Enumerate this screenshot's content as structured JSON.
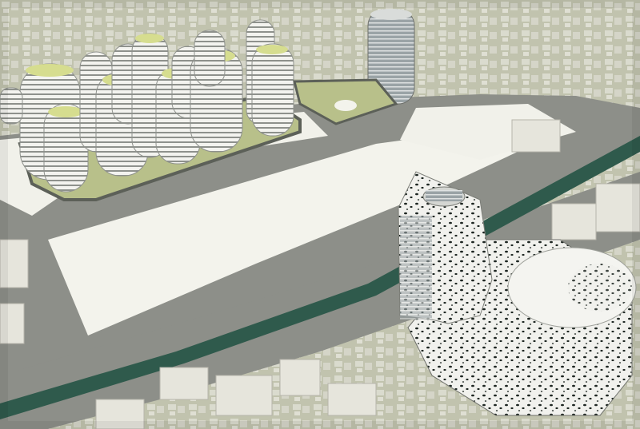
{
  "scene": {
    "kind": "architectural-render",
    "palette": {
      "sky_ground": "#c9cbb8",
      "road": "#8d8f89",
      "road_dark": "#6e706b",
      "plaza": "#f3f3ec",
      "canal": "#2f5a4c",
      "tower": "#f2f2ee",
      "tower_shadow": "#b9bab4",
      "roof_green": "#d6dd8f",
      "lawn": "#b8c08a",
      "block": "#e6e5dc",
      "dot": "#1e2622"
    }
  }
}
